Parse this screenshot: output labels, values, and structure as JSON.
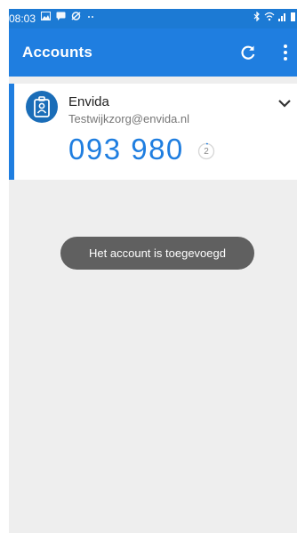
{
  "status_bar": {
    "time": "08:03",
    "left_icons": [
      "image-icon",
      "message-icon",
      "sync-off-icon",
      "more-dots-icon"
    ],
    "right_icons": [
      "bluetooth-icon",
      "wifi-icon",
      "signal-icon",
      "battery-icon"
    ]
  },
  "app_bar": {
    "title": "Accounts",
    "refresh_icon": "refresh-icon",
    "menu_icon": "overflow-menu-icon"
  },
  "account": {
    "name": "Envida",
    "email": "Testwijkzorg@envida.nl",
    "code": "093 980",
    "timer": "2",
    "icon": "id-badge-icon",
    "expand_icon": "chevron-down-icon"
  },
  "toast": {
    "message": "Het account is toegevoegd"
  },
  "colors": {
    "accent": "#1f7ee0",
    "status_bar": "#1c7ad4",
    "background": "#eeeeee",
    "toast": "#606060"
  }
}
